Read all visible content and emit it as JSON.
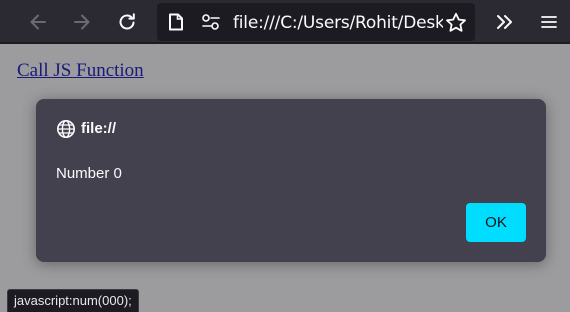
{
  "browser": {
    "url": "file:///C:/Users/Rohit/Desktop",
    "icons": {
      "back": "back-arrow-icon",
      "forward": "forward-arrow-icon",
      "reload": "reload-icon",
      "page": "page-icon",
      "permissions": "permissions-icon",
      "bookmark": "star-icon",
      "overflow": "chevrons-right-icon",
      "menu": "hamburger-menu-icon"
    }
  },
  "page": {
    "link_text": "Call JS Function"
  },
  "dialog": {
    "title": "file://",
    "message": "Number 0",
    "ok_label": "OK",
    "accent": "#00ddff"
  },
  "status_bar": {
    "text": "javascript:num(000);"
  }
}
